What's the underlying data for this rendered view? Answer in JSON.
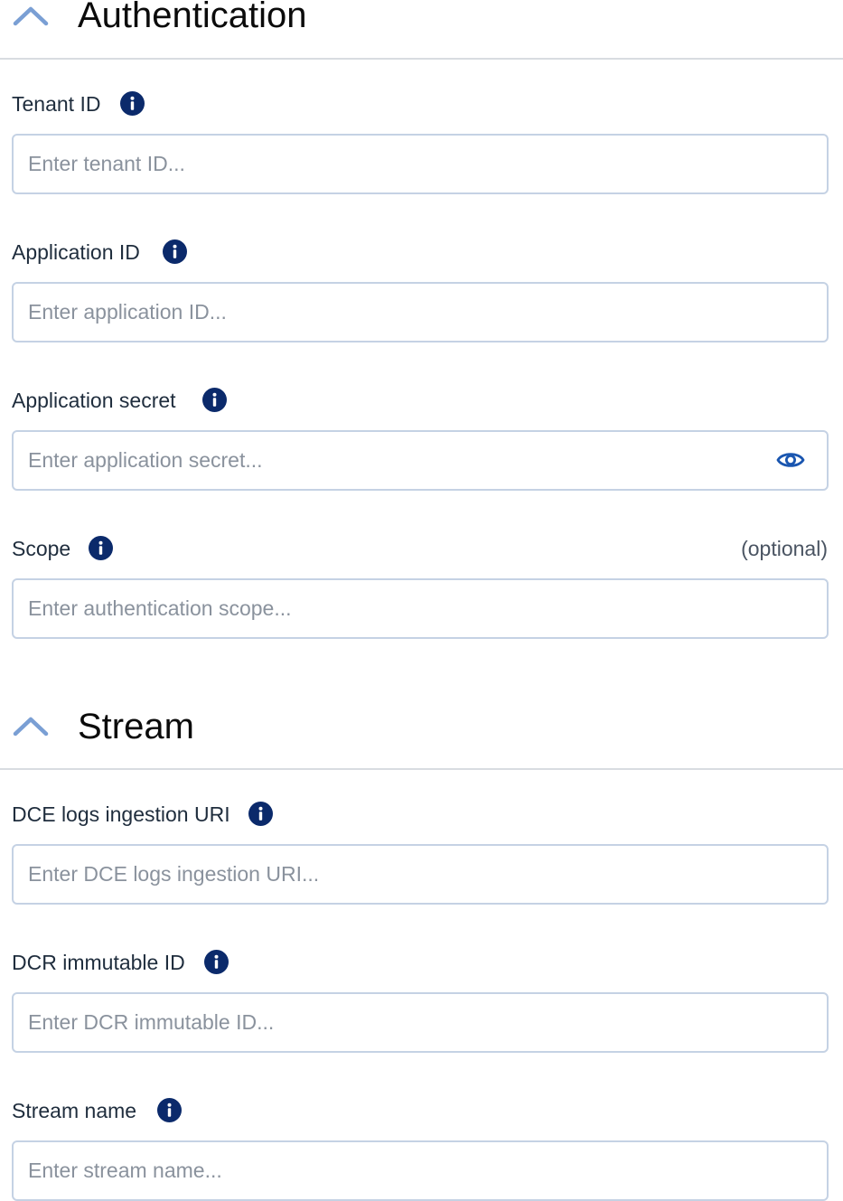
{
  "sections": [
    {
      "title": "Authentication",
      "toggle_icon": "chevron-up-icon",
      "fields": [
        {
          "label": "Tenant ID",
          "placeholder": "Enter tenant ID...",
          "value": ""
        },
        {
          "label": "Application ID",
          "placeholder": "Enter application ID...",
          "value": ""
        },
        {
          "label": "Application secret",
          "placeholder": "Enter application secret...",
          "value": "",
          "reveal_icon": "eye-icon"
        },
        {
          "label": "Scope",
          "optional": "(optional)",
          "placeholder": "Enter authentication scope...",
          "value": ""
        }
      ]
    },
    {
      "title": "Stream",
      "toggle_icon": "chevron-up-icon",
      "fields": [
        {
          "label": "DCE logs ingestion URI",
          "placeholder": "Enter DCE logs ingestion URI...",
          "value": ""
        },
        {
          "label": "DCR immutable ID",
          "placeholder": "Enter DCR immutable ID...",
          "value": ""
        },
        {
          "label": "Stream name",
          "placeholder": "Enter stream name...",
          "value": ""
        }
      ]
    }
  ],
  "colors": {
    "info_icon_bg": "#0b2a6b",
    "chevron": "#7a9fd4",
    "eye_icon": "#1a56b0",
    "input_border": "#c5d2e4",
    "divider": "#d8dce1"
  }
}
